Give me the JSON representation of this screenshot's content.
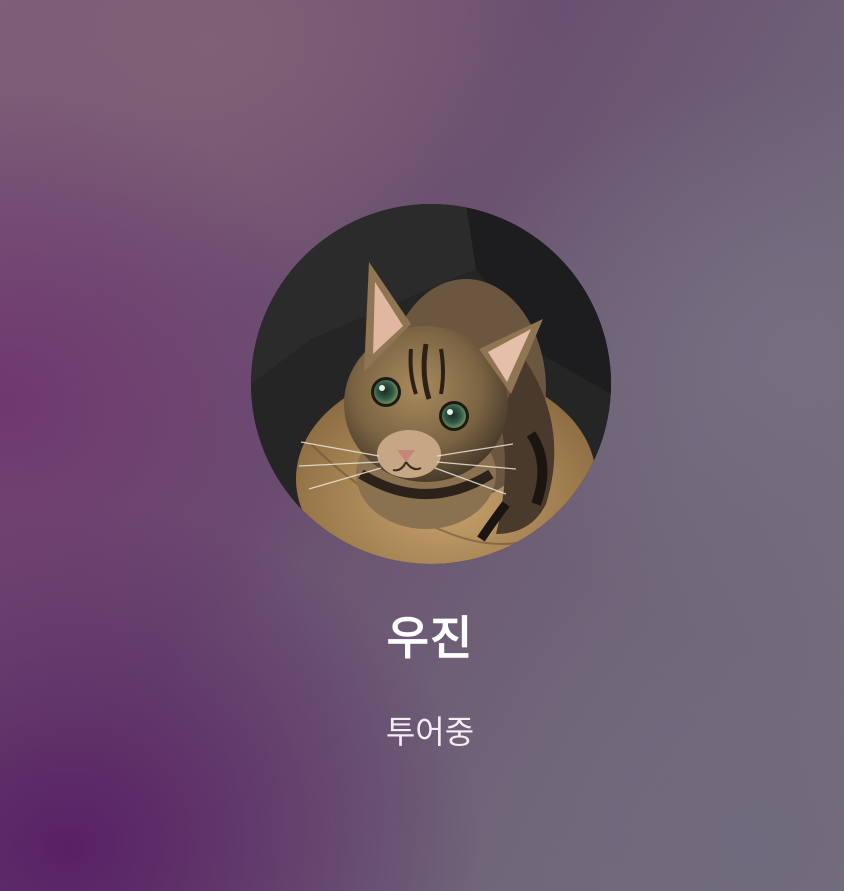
{
  "profile": {
    "name": "우진",
    "status": "투어중",
    "avatar_icon": "cat-photo"
  },
  "colors": {
    "name_text": "#ffffff",
    "status_text": "#f4eef4",
    "background_primary": "#6a4f70",
    "background_secondary": "#75717d"
  }
}
